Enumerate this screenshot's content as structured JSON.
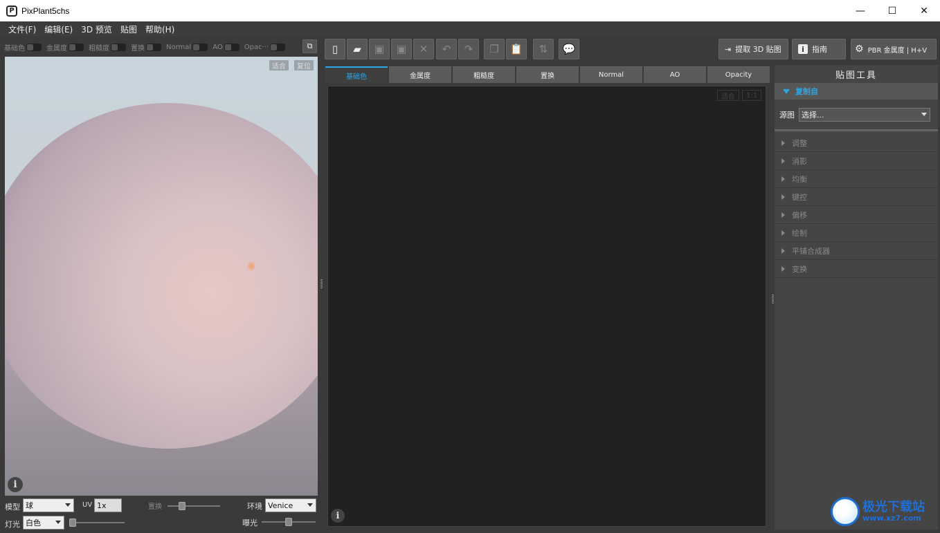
{
  "window": {
    "title": "PixPlant5chs",
    "minimize": "—",
    "maximize": "☐",
    "close": "✕"
  },
  "menu": [
    "文件(F)",
    "编辑(E)",
    "3D 预览",
    "贴图",
    "帮助(H)"
  ],
  "channels": [
    "基础色",
    "金属度",
    "粗糙度",
    "置换",
    "Normal",
    "AO",
    "Opac···"
  ],
  "viewport": {
    "fit": "适合",
    "reset": "复位"
  },
  "bottom": {
    "model_label": "模型",
    "model_value": "球",
    "uv_label": "UV",
    "uv_value": "1x",
    "displace_label": "置换",
    "env_label": "环境",
    "env_value": "Venice",
    "light_label": "灯光",
    "light_value": "白色",
    "exposure_label": "曝光"
  },
  "toolbar": {
    "extract": "提取 3D 贴图",
    "guide": "指南",
    "pbr": "PBR 金属度 | H+V"
  },
  "tabs": [
    "基础色",
    "金属度",
    "粗糙度",
    "置换",
    "Normal",
    "AO",
    "Opacity"
  ],
  "canvas": {
    "fit": "适合",
    "one_to_one": "1:1"
  },
  "right_panel": {
    "title": "贴图工具",
    "section": "复制自",
    "source_label": "源图",
    "source_value": "选择...",
    "items": [
      "调整",
      "消影",
      "均衡",
      "键控",
      "偏移",
      "绘制",
      "平铺合成器",
      "变换"
    ]
  },
  "watermark": {
    "cn": "极光下载站",
    "en": "www.xz7.com"
  }
}
